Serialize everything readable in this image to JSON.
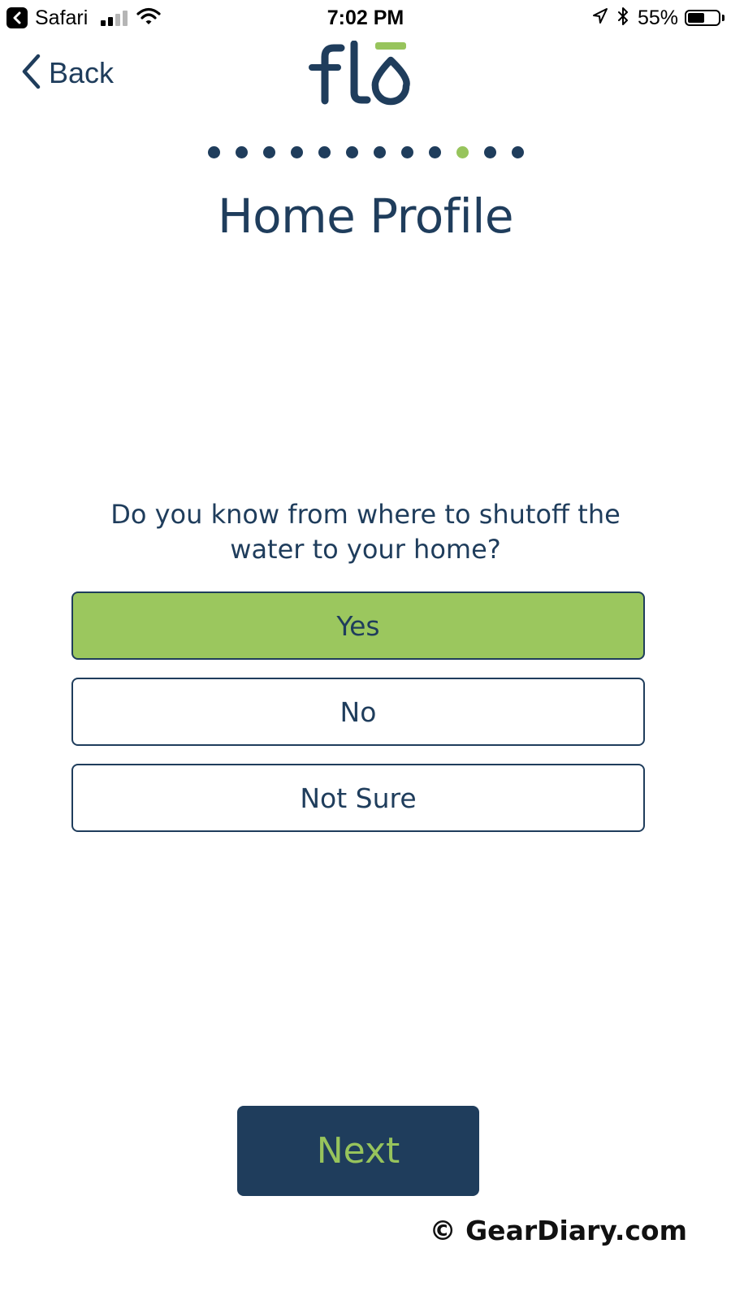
{
  "status_bar": {
    "app_name": "Safari",
    "time": "7:02 PM",
    "battery_percent": "55%",
    "battery_level": 0.55,
    "signal_bars": 2,
    "icons": [
      "back-to-app-icon",
      "cellular-signal-icon",
      "wifi-icon",
      "location-arrow-icon",
      "bluetooth-icon",
      "battery-icon"
    ]
  },
  "nav": {
    "back_label": "Back",
    "back_icon": "chevron-left-icon",
    "logo_text": "flō"
  },
  "progress": {
    "total_steps": 12,
    "current_step": 10
  },
  "page_title": "Home Profile",
  "question": "Do you know from where to shutoff the water to your home?",
  "options": [
    {
      "label": "Yes",
      "selected": true
    },
    {
      "label": "No",
      "selected": false
    },
    {
      "label": "Not Sure",
      "selected": false
    }
  ],
  "next_label": "Next",
  "watermark": "© GearDiary.com",
  "colors": {
    "navy": "#1f3d5c",
    "green": "#97c45c",
    "selected_fill": "#9bc75e",
    "background": "#ffffff"
  }
}
